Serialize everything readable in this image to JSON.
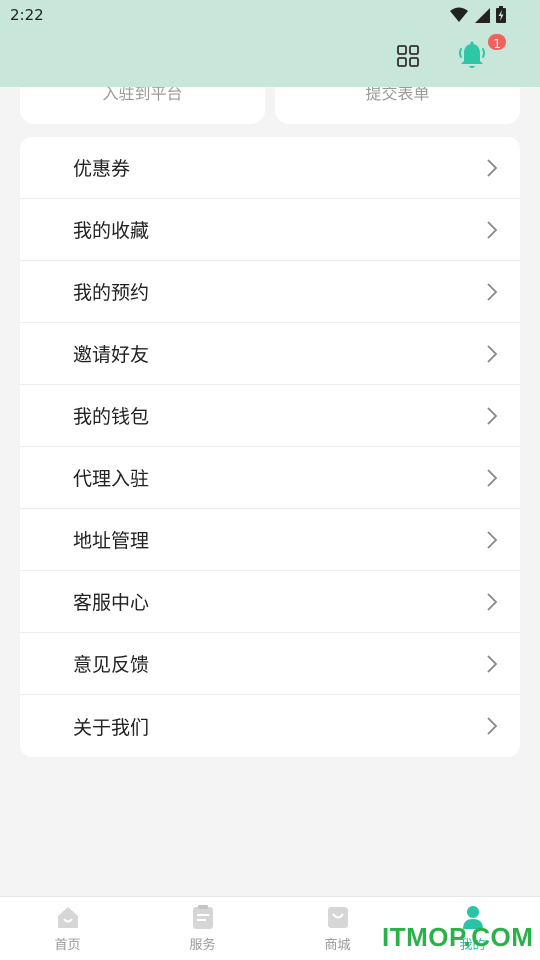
{
  "status": {
    "time": "2:22"
  },
  "header": {
    "notification_count": "1",
    "accent": "#2ec7a6",
    "background": "#c8e6d9"
  },
  "top_cards": [
    {
      "label": "入驻到平台"
    },
    {
      "label": "提交表单"
    }
  ],
  "menu": {
    "items": [
      {
        "label": "优惠券"
      },
      {
        "label": "我的收藏"
      },
      {
        "label": "我的预约"
      },
      {
        "label": "邀请好友"
      },
      {
        "label": "我的钱包"
      },
      {
        "label": "代理入驻"
      },
      {
        "label": "地址管理"
      },
      {
        "label": "客服中心"
      },
      {
        "label": "意见反馈"
      },
      {
        "label": "关于我们"
      }
    ]
  },
  "bottom_nav": {
    "items": [
      {
        "label": "首页",
        "icon": "home-icon"
      },
      {
        "label": "服务",
        "icon": "clipboard-icon"
      },
      {
        "label": "商城",
        "icon": "shopping-bag-icon"
      },
      {
        "label": "我的",
        "icon": "user-icon",
        "active": true
      }
    ]
  },
  "watermark": {
    "text": "ITMOP.COM"
  }
}
